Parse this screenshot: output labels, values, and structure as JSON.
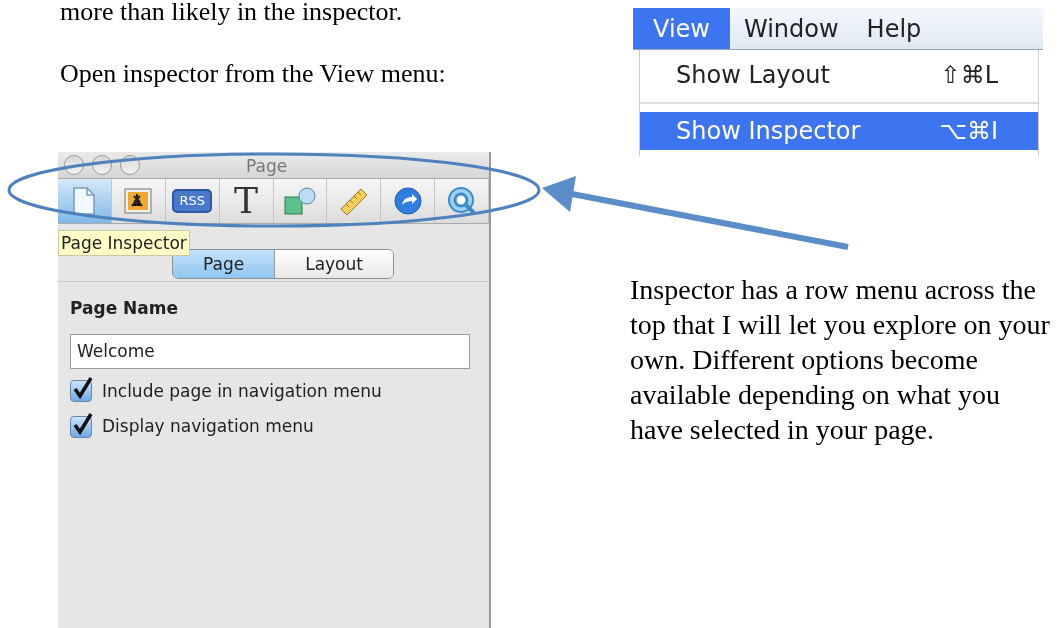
{
  "document": {
    "intro_line": "more than likely in the inspector.",
    "instruction": "Open inspector from the View menu:",
    "explanation": "Inspector has a row menu across the top that I will let you explore on your own.  Different options become available depending on what you have selected in your page."
  },
  "menu_bar": {
    "items": [
      {
        "label": "View",
        "selected": true
      },
      {
        "label": "Window",
        "selected": false
      },
      {
        "label": "Help",
        "selected": false
      }
    ],
    "menu_items": [
      {
        "label": "Show Layout",
        "shortcut": "⇧⌘L",
        "selected": false
      },
      {
        "label": "Show Inspector",
        "shortcut": "⌥⌘I",
        "selected": true
      }
    ]
  },
  "inspector": {
    "title": "Page",
    "toolbar": [
      {
        "kind": "page",
        "selected": true
      },
      {
        "kind": "photo",
        "selected": false
      },
      {
        "kind": "rss",
        "label": "RSS",
        "selected": false
      },
      {
        "kind": "text",
        "label": "T",
        "selected": false
      },
      {
        "kind": "shapes",
        "selected": false
      },
      {
        "kind": "ruler",
        "selected": false
      },
      {
        "kind": "link",
        "selected": false
      },
      {
        "kind": "quicktime",
        "selected": false
      }
    ],
    "tooltip": "Page Inspector",
    "tabs": [
      {
        "label": "Page",
        "selected": true
      },
      {
        "label": "Layout",
        "selected": false
      }
    ],
    "page_name_label": "Page Name",
    "page_name_value": "Welcome",
    "checkboxes": [
      {
        "label": "Include page in navigation menu",
        "checked": true
      },
      {
        "label": "Display navigation menu",
        "checked": true
      }
    ]
  }
}
